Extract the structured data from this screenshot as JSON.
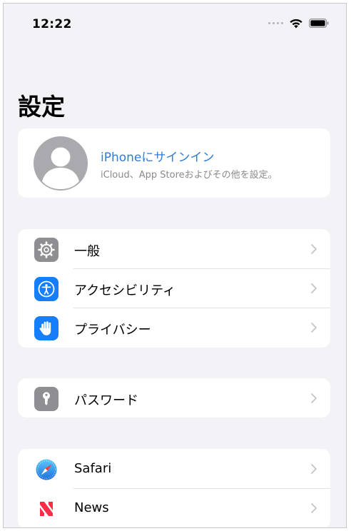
{
  "status_bar": {
    "time": "12:22",
    "icons": [
      "signal-dots-icon",
      "wifi-icon",
      "battery-icon"
    ]
  },
  "page": {
    "title": "設定"
  },
  "profile": {
    "title": "iPhoneにサインイン",
    "subtitle": "iCloud、App Storeおよびその他を設定。",
    "icon": "person-avatar-icon"
  },
  "groups": [
    {
      "items": [
        {
          "label": "一般",
          "icon": "gear-icon",
          "icon_color": "#8e8e93"
        },
        {
          "label": "アクセシビリティ",
          "icon": "accessibility-icon",
          "icon_color": "#147efb"
        },
        {
          "label": "プライバシー",
          "icon": "hand-icon",
          "icon_color": "#147efb"
        }
      ]
    },
    {
      "items": [
        {
          "label": "パスワード",
          "icon": "key-icon",
          "icon_color": "#8e8e93"
        }
      ]
    },
    {
      "items": [
        {
          "label": "Safari",
          "icon": "safari-compass-icon",
          "icon_color": "#1e90ff"
        },
        {
          "label": "News",
          "icon": "news-icon",
          "icon_color": "#fa2d48"
        }
      ]
    }
  ],
  "colors": {
    "background": "#f2f2f7",
    "card": "#ffffff",
    "accent_blue": "#2f7bdc",
    "secondary_text": "#8a8a8e",
    "chevron": "#c4c4c7"
  }
}
